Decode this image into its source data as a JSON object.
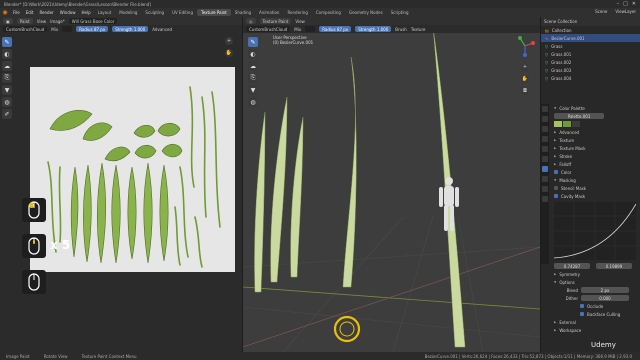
{
  "window": {
    "title": "Blender* [D:\\Work\\2021\\Udemy\\Blender\\Grass\\Lesson\\Blender File.blend]",
    "controls": [
      "–",
      "□",
      "✕"
    ]
  },
  "menu": {
    "items": [
      "File",
      "Edit",
      "Render",
      "Window",
      "Help"
    ],
    "workspaces": [
      "Layout",
      "Modeling",
      "Sculpting",
      "UV Editing",
      "Texture Paint",
      "Shading",
      "Animation",
      "Rendering",
      "Compositing",
      "Geometry Nodes",
      "Scripting"
    ],
    "active_workspace": "Texture Paint",
    "scene_label": "Scene",
    "view_layer_label": "ViewLayer"
  },
  "uv_header": {
    "mode": "Paint",
    "view": "View",
    "image": "Image*",
    "image_name": "Will Grass Base Color",
    "brush": "CustomBrushCloud",
    "blend": "Mix",
    "radius_label": "Radius",
    "radius_value": "87 px",
    "strength_label": "Strength",
    "strength_value": "1.000",
    "advanced": "Advanced"
  },
  "vp_header": {
    "mode": "Texture Paint",
    "view": "View",
    "brush": "CustomBrushCloud",
    "blend": "Mix",
    "radius_label": "Radius",
    "radius_value": "87 px",
    "strength_label": "Strength",
    "strength_value": "1.000",
    "brush_menu": "Brush",
    "texture_menu": "Texture"
  },
  "viewport": {
    "line1": "User Perspective",
    "line2": "(0) BezierCurve.001"
  },
  "overlay": {
    "multiplier": "x 5"
  },
  "outliner": {
    "title": "Scene Collection",
    "rows": [
      {
        "name": "Collection",
        "type": "collection"
      },
      {
        "name": "BezierCurve.001",
        "type": "curve"
      },
      {
        "name": "Grass",
        "type": "mesh"
      },
      {
        "name": "Grass.001",
        "type": "mesh"
      },
      {
        "name": "Grass.002",
        "type": "mesh"
      },
      {
        "name": "Grass.003",
        "type": "mesh"
      },
      {
        "name": "Grass.004",
        "type": "mesh"
      }
    ]
  },
  "properties": {
    "color_palette": "Color Palette",
    "palette_name": "Palette.001",
    "sections": [
      "Advanced",
      "Texture",
      "Texture Mask",
      "Stroke",
      "Falloff"
    ],
    "color_label": "Color",
    "masking": "Masking",
    "stencil_mask": "Stencil Mask",
    "cavity_mask": "Cavity Mask",
    "curve_x": "0.74287",
    "curve_y": "0.19899",
    "symmetry": "Symmetry",
    "options": "Options",
    "bleed_label": "Bleed",
    "bleed_value": "2 px",
    "dither_label": "Dither",
    "dither_value": "0.000",
    "occlude": "Occlude",
    "backface_culling": "Backface Culling",
    "external": "External",
    "workspace": "Workspace"
  },
  "status": {
    "left": "Image Paint",
    "mid": "Rotate View",
    "right1": "Texture Paint Context Menu",
    "stats": "BezierCurve.001 | Verts:26,624 | Faces:26,433 | Tris:52,873 | Objects:1/11 | Memory: 366.9 MiB | 2.93.0"
  },
  "watermark": "Udemy",
  "colors": {
    "accent": "#4772b3",
    "leaf_green": "#7ba33f",
    "leaf_dark": "#4e6b1f",
    "cursor_ring": "#e8c20a",
    "orange": "#e87d0d"
  }
}
